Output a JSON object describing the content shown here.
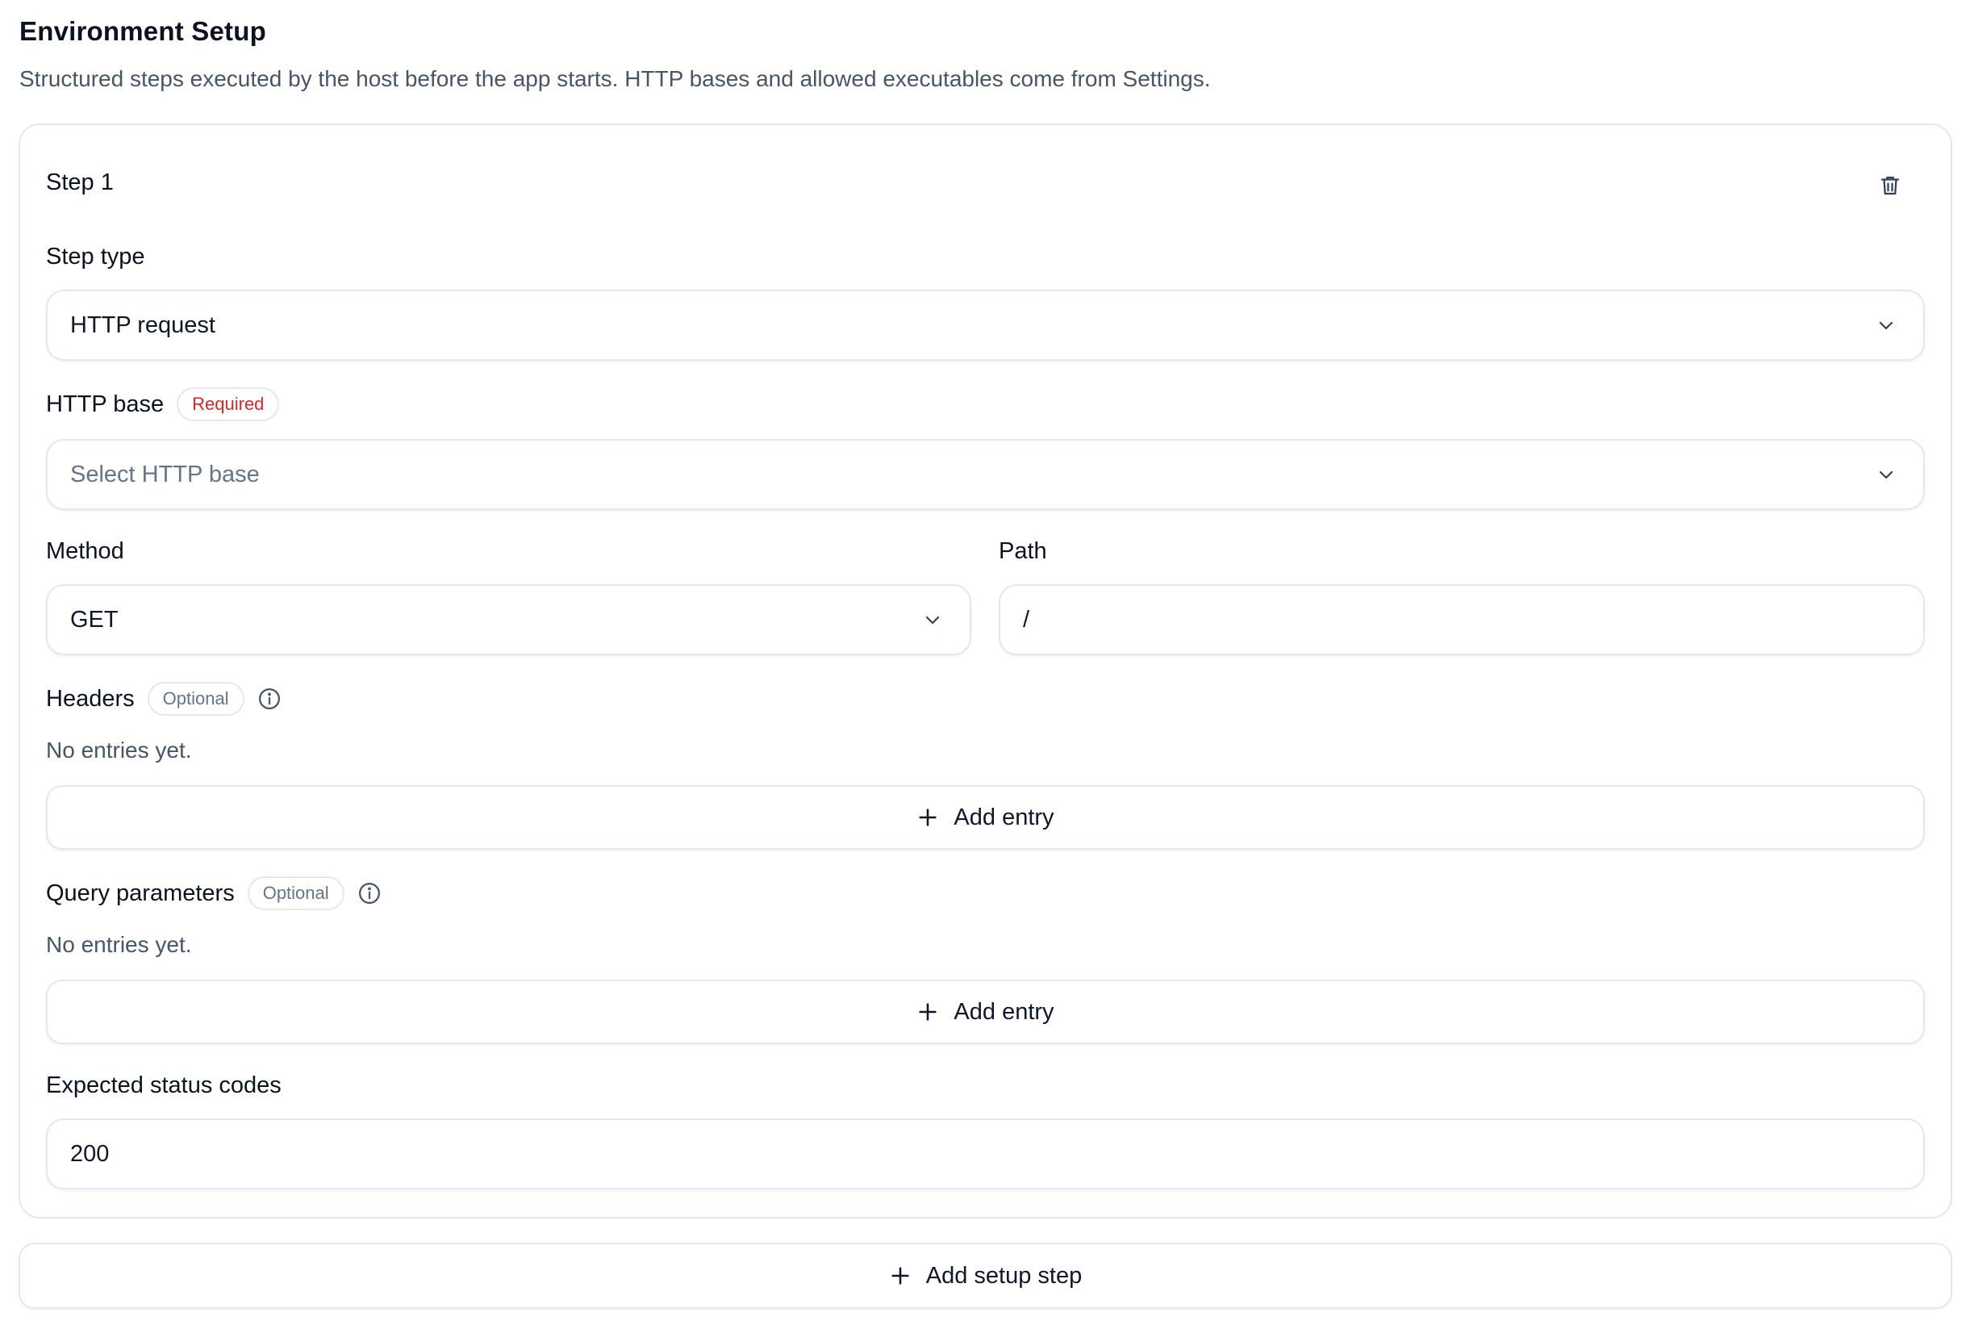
{
  "header": {
    "title": "Environment Setup",
    "description": "Structured steps executed by the host before the app starts. HTTP bases and allowed executables come from Settings."
  },
  "step": {
    "title": "Step 1",
    "delete_icon": "trash-icon",
    "step_type": {
      "label": "Step type",
      "value": "HTTP request"
    },
    "http_base": {
      "label": "HTTP base",
      "badge": "Required",
      "placeholder": "Select HTTP base"
    },
    "method": {
      "label": "Method",
      "value": "GET"
    },
    "path": {
      "label": "Path",
      "value": "/"
    },
    "headers": {
      "label": "Headers",
      "badge": "Optional",
      "empty_text": "No entries yet.",
      "add_label": "Add entry"
    },
    "query_params": {
      "label": "Query parameters",
      "badge": "Optional",
      "empty_text": "No entries yet.",
      "add_label": "Add entry"
    },
    "expected_status": {
      "label": "Expected status codes",
      "value": "200"
    }
  },
  "footer": {
    "add_step_label": "Add setup step"
  },
  "colors": {
    "required": "#dc2626",
    "border": "#e2e8f0",
    "muted": "#475569"
  }
}
